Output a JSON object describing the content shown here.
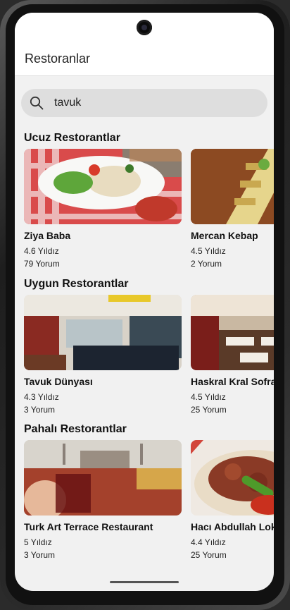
{
  "app": {
    "title": "Restoranlar"
  },
  "search": {
    "value": "tavuk",
    "icon": "search-icon"
  },
  "sections": [
    {
      "heading": "Ucuz Restorantlar",
      "cards": [
        {
          "name": "Ziya Baba",
          "rating": "4.6 Yıldız",
          "reviews": "79 Yorum",
          "image": "plate-of-rice-and-salad"
        },
        {
          "name": "Mercan Kebap",
          "rating": "4.5 Yıldız",
          "reviews": "2 Yorum",
          "image": "flatbread-pide-on-board"
        }
      ]
    },
    {
      "heading": "Uygun Restorantlar",
      "cards": [
        {
          "name": "Tavuk Dünyası",
          "rating": "4.3 Yıldız",
          "reviews": "3 Yorum",
          "image": "restaurant-interior"
        },
        {
          "name": "Haskral Kral Sofrası",
          "rating": "4.5 Yıldız",
          "reviews": "25 Yorum",
          "image": "dining-hall-tables"
        }
      ]
    },
    {
      "heading": "Pahalı Restorantlar",
      "cards": [
        {
          "name": "Turk Art Terrace Restaurant",
          "rating": "5 Yıldız",
          "reviews": "3 Yorum",
          "image": "tea-glass-over-city-view"
        },
        {
          "name": "Hacı Abdullah Lokantası",
          "rating": "4.4 Yıldız",
          "reviews": "25 Yorum",
          "image": "meat-stew-with-pepper"
        }
      ]
    }
  ],
  "colors": {
    "screen_bg": "#f1f1f1",
    "appbar_bg": "#ffffff",
    "search_bg": "#dedede"
  }
}
